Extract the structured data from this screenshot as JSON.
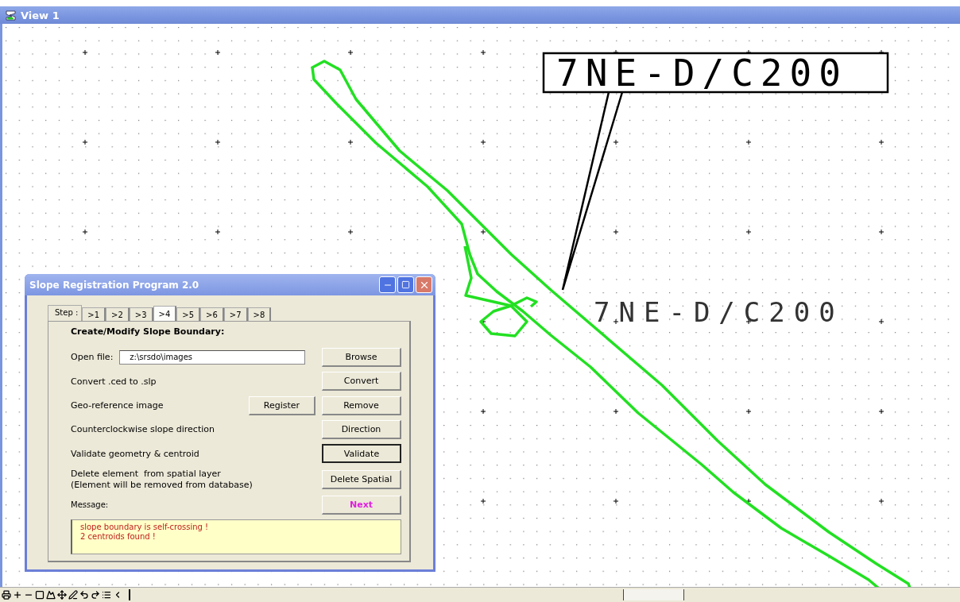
{
  "window": {
    "title": "View 1"
  },
  "canvas": {
    "callout": "7NE-D/C200",
    "label": "7NE-D/C200"
  },
  "dialog": {
    "title": "Slope Registration Program 2.0",
    "tabs_prefix": "Step :",
    "tabs": [
      {
        "label": ">1",
        "selected": false
      },
      {
        "label": ">2",
        "selected": false
      },
      {
        "label": ">3",
        "selected": false
      },
      {
        "label": ">4",
        "selected": true
      },
      {
        "label": ">5",
        "selected": false
      },
      {
        "label": ">6",
        "selected": false
      },
      {
        "label": ">7",
        "selected": false
      },
      {
        "label": ">8",
        "selected": false
      }
    ],
    "heading": "Create/Modify Slope Boundary:",
    "rows": [
      {
        "kind": "file",
        "label": "Open file:",
        "value": "z:\\srsdo\\images",
        "buttons": [
          {
            "label": "Browse",
            "kind": "plain"
          }
        ]
      },
      {
        "kind": "action",
        "label": "Convert .ced to .slp",
        "buttons": [
          {
            "label": "Convert",
            "kind": "plain"
          }
        ]
      },
      {
        "kind": "action",
        "label": "Geo-reference image",
        "buttons": [
          {
            "label": "Register",
            "kind": "plain"
          },
          {
            "label": "Remove",
            "kind": "plain"
          }
        ]
      },
      {
        "kind": "action",
        "label": "Counterclockwise slope direction",
        "buttons": [
          {
            "label": "Direction",
            "kind": "plain"
          }
        ]
      },
      {
        "kind": "action",
        "label": "Validate geometry & centroid",
        "buttons": [
          {
            "label": "Validate",
            "kind": "focused"
          }
        ]
      },
      {
        "kind": "note",
        "lines": [
          "Delete element  from spatial layer",
          "(Element will be removed from database)"
        ],
        "buttons": [
          {
            "label": "Delete Spatial",
            "kind": "plain"
          }
        ]
      },
      {
        "kind": "small",
        "label": "Message:",
        "buttons": [
          {
            "label": "Next",
            "kind": "accent"
          }
        ]
      }
    ],
    "messages": [
      "slope boundary is self-crossing !",
      "2 centroids found !"
    ]
  }
}
